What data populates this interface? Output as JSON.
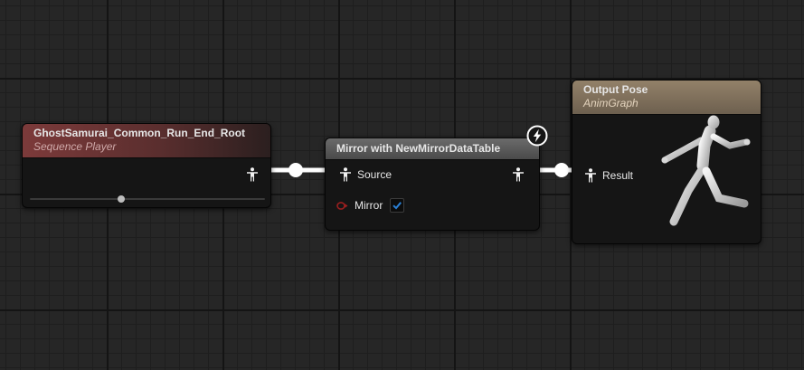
{
  "nodes": {
    "sequence_player": {
      "title": "GhostSamurai_Common_Run_End_Root",
      "subtitle": "Sequence Player",
      "play_position": 0.39
    },
    "mirror": {
      "title": "Mirror with NewMirrorDataTable",
      "source_label": "Source",
      "mirror_label": "Mirror",
      "mirror_checked": true
    },
    "output_pose": {
      "title": "Output Pose",
      "subtitle": "AnimGraph",
      "result_label": "Result"
    }
  },
  "icons": {
    "pose_pin": "pose-person-icon",
    "bool_pin": "bool-pin-icon",
    "fast_path": "lightning-icon",
    "preview": "mannequin-preview-icon"
  },
  "colors": {
    "wire": "#ffffff",
    "bool_pin": "#8c1a1a",
    "checkbox_check": "#2a7fd4",
    "sequence_header": "#7c3a3a",
    "mirror_header": "#5e5e5e",
    "output_header": "#857561"
  }
}
